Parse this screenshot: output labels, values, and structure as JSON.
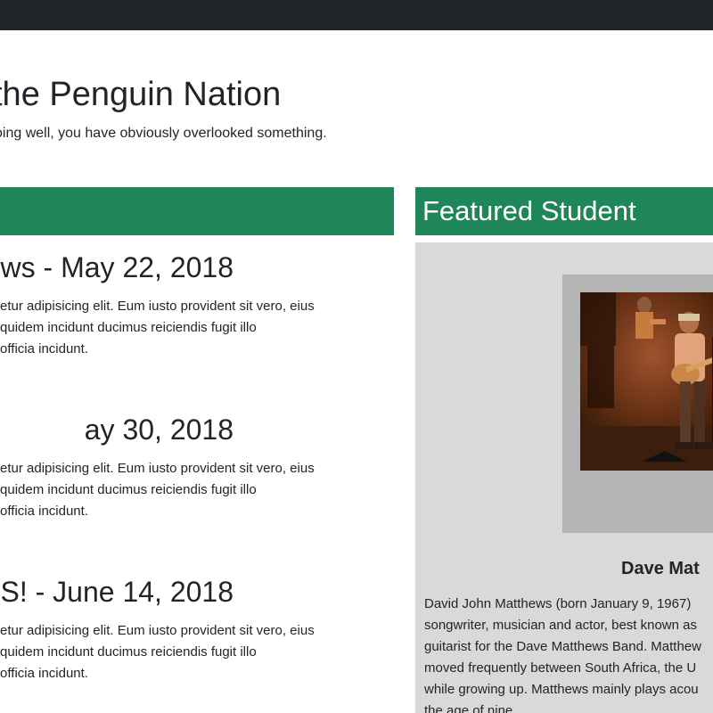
{
  "hero": {
    "title": "the Penguin Nation",
    "subtitle": "oing well, you have obviously overlooked something."
  },
  "news": {
    "items": [
      {
        "title": "ws - May 22, 2018",
        "lines": [
          ", consectetur adipisicing elit. Eum iusto provident sit vero, eius",
          "olestiae, quidem incidunt ducimus reiciendis fugit illo",
          "voluptas officia incidunt."
        ]
      },
      {
        "title": "ay 30, 2018",
        "lines": [
          ", consectetur adipisicing elit. Eum iusto provident sit vero, eius",
          "olestiae, quidem incidunt ducimus reiciendis fugit illo",
          "voluptas officia incidunt."
        ]
      },
      {
        "title": "S! - June 14, 2018",
        "lines": [
          ", consectetur adipisicing elit. Eum iusto provident sit vero, eius",
          "olestiae, quidem incidunt ducimus reiciendis fugit illo",
          "voluptas officia incidunt."
        ]
      }
    ]
  },
  "featured": {
    "heading": "Featured Student",
    "name": "Dave Mat",
    "bio_lines": [
      "David John Matthews (born January 9, 1967)",
      "songwriter, musician and actor, best known as",
      "guitarist for the Dave Matthews Band. Matthew",
      "moved frequently between South Africa, the U",
      "while growing up. Matthews mainly plays acou",
      "the age of nine."
    ]
  },
  "colors": {
    "topbar": "#212529",
    "accent_green": "#1e8658",
    "panel_gray": "#d9d9d9",
    "frame_gray": "#b5b5b5"
  }
}
